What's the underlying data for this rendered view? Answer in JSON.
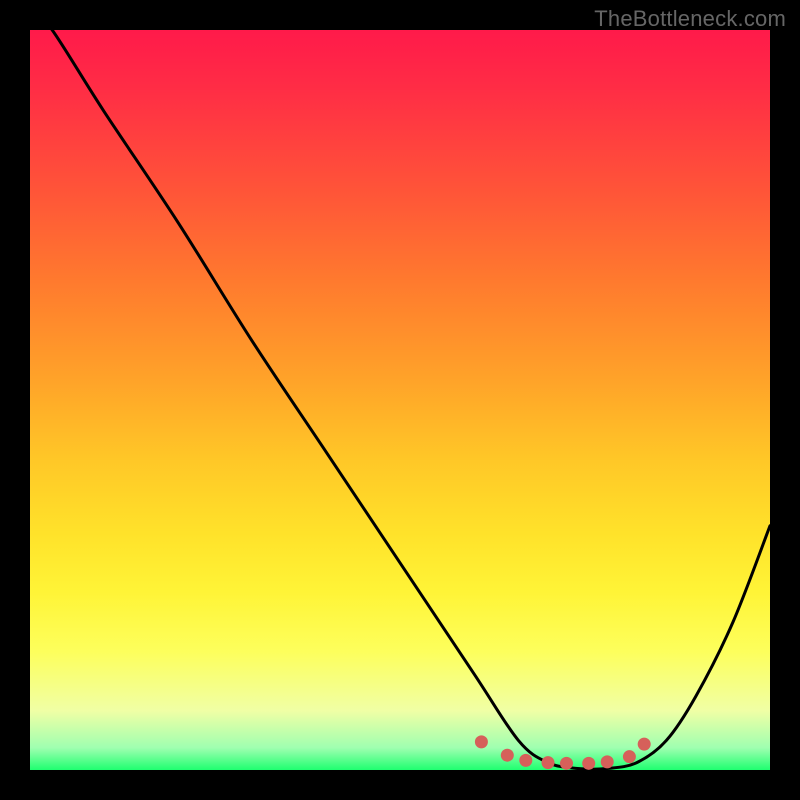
{
  "attribution": "TheBottleneck.com",
  "chart_data": {
    "type": "line",
    "title": "",
    "xlabel": "",
    "ylabel": "",
    "xlim": [
      0,
      100
    ],
    "ylim": [
      0,
      100
    ],
    "series": [
      {
        "name": "curve",
        "x": [
          0,
          3,
          10,
          20,
          30,
          40,
          50,
          60,
          66,
          70,
          74,
          78,
          82,
          86,
          90,
          95,
          100
        ],
        "values": [
          103,
          100,
          89,
          74,
          58,
          43,
          28,
          13,
          4,
          1,
          0.2,
          0.2,
          1,
          4,
          10,
          20,
          33
        ]
      }
    ],
    "markers": {
      "name": "highlight-dots",
      "color": "#d6605a",
      "x": [
        61,
        64.5,
        67,
        70,
        72.5,
        75.5,
        78,
        81,
        83
      ],
      "values": [
        3.8,
        2.0,
        1.3,
        1.0,
        0.9,
        0.9,
        1.1,
        1.8,
        3.5
      ]
    }
  }
}
